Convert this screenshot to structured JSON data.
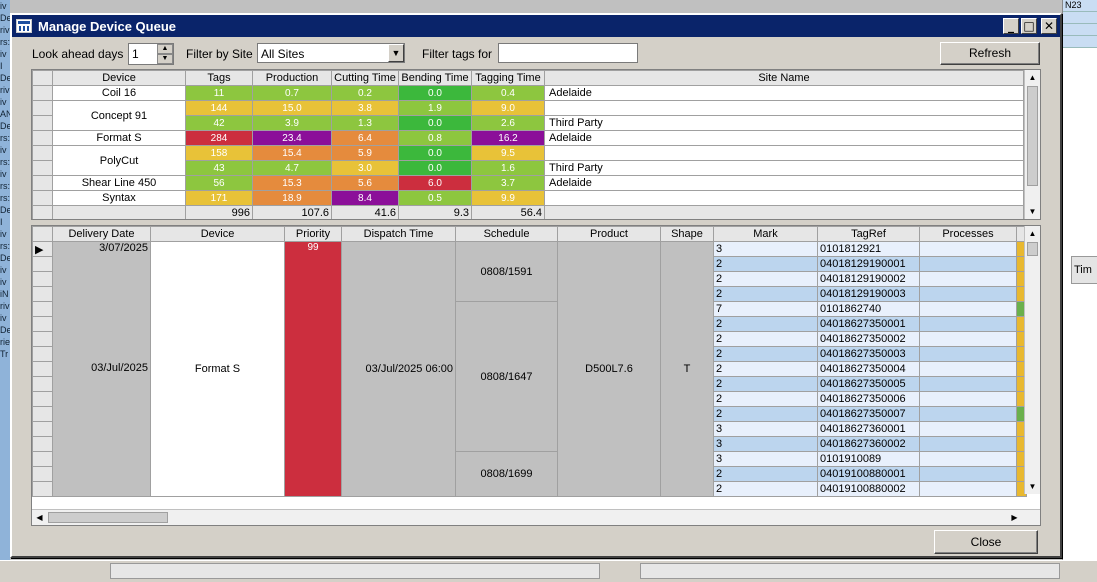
{
  "dialog": {
    "title": "Manage Device Queue",
    "minimize_glyph": "_",
    "maximize_glyph": "□",
    "close_glyph": "✕"
  },
  "toolbar": {
    "look_ahead_label": "Look ahead days",
    "look_ahead_value": "1",
    "filter_site_label": "Filter by Site",
    "filter_site_value": "All Sites",
    "filter_tags_label": "Filter tags for",
    "filter_tags_value": "",
    "refresh_label": "Refresh"
  },
  "summary": {
    "columns": [
      "Device",
      "Tags",
      "Production",
      "Cutting Time",
      "Bending Time",
      "Tagging Time",
      "Site Name"
    ],
    "devices": [
      {
        "name": "Coil 16",
        "rows": [
          {
            "tags": "11",
            "production": "0.7",
            "cutting": "0.2",
            "bending": "0.0",
            "tagging": "0.4",
            "site": "Adelaide",
            "colors": [
              "#8dc63f",
              "#8dc63f",
              "#8dc63f",
              "#3cb83c",
              "#8dc63f"
            ]
          }
        ]
      },
      {
        "name": "Concept 91",
        "rows": [
          {
            "tags": "144",
            "production": "15.0",
            "cutting": "3.8",
            "bending": "1.9",
            "tagging": "9.0",
            "site": "",
            "colors": [
              "#e8c238",
              "#e8c238",
              "#e8c238",
              "#8dc63f",
              "#e8c238"
            ]
          },
          {
            "tags": "42",
            "production": "3.9",
            "cutting": "1.3",
            "bending": "0.0",
            "tagging": "2.6",
            "site": "Third Party",
            "colors": [
              "#8dc63f",
              "#8dc63f",
              "#8dc63f",
              "#3cb83c",
              "#8dc63f"
            ]
          }
        ]
      },
      {
        "name": "Format S",
        "rows": [
          {
            "tags": "284",
            "production": "23.4",
            "cutting": "6.4",
            "bending": "0.8",
            "tagging": "16.2",
            "site": "Adelaide",
            "colors": [
              "#cc2e3e",
              "#8b0f99",
              "#e58b3d",
              "#8dc63f",
              "#8b0f99"
            ]
          }
        ]
      },
      {
        "name": "PolyCut",
        "rows": [
          {
            "tags": "158",
            "production": "15.4",
            "cutting": "5.9",
            "bending": "0.0",
            "tagging": "9.5",
            "site": "",
            "colors": [
              "#e8c238",
              "#e58b3d",
              "#e58b3d",
              "#3cb83c",
              "#e8c238"
            ]
          },
          {
            "tags": "43",
            "production": "4.7",
            "cutting": "3.0",
            "bending": "0.0",
            "tagging": "1.6",
            "site": "Third Party",
            "colors": [
              "#8dc63f",
              "#8dc63f",
              "#e8c238",
              "#3cb83c",
              "#8dc63f"
            ]
          }
        ]
      },
      {
        "name": "Shear Line 450",
        "rows": [
          {
            "tags": "56",
            "production": "15.3",
            "cutting": "5.6",
            "bending": "6.0",
            "tagging": "3.7",
            "site": "Adelaide",
            "colors": [
              "#8dc63f",
              "#e58b3d",
              "#e58b3d",
              "#cc2e3e",
              "#8dc63f"
            ]
          }
        ]
      },
      {
        "name": "Syntax",
        "rows": [
          {
            "tags": "171",
            "production": "18.9",
            "cutting": "8.4",
            "bending": "0.5",
            "tagging": "9.9",
            "site": "",
            "colors": [
              "#e8c238",
              "#e58b3d",
              "#8b0f99",
              "#8dc63f",
              "#e8c238"
            ]
          }
        ]
      }
    ],
    "totals": {
      "tags": "996",
      "production": "107.6",
      "cutting": "41.6",
      "bending": "9.3",
      "tagging": "56.4"
    }
  },
  "queue": {
    "columns": [
      "Delivery Date",
      "Device",
      "Priority",
      "Dispatch Time",
      "Schedule",
      "Product",
      "Shape",
      "Mark",
      "TagRef",
      "Processes"
    ],
    "first_row_date": "3/07/2025",
    "delivery_date": "03/Jul/2025",
    "device": "Format S",
    "priority": "99",
    "dispatch_time": "03/Jul/2025 06:00",
    "product": "D500L7.6",
    "shape": "T",
    "schedules": [
      {
        "id": "0808/1591",
        "rows": 4
      },
      {
        "id": "0808/1647",
        "rows": 10
      },
      {
        "id": "0808/1699",
        "rows": 3
      }
    ],
    "tags": [
      {
        "mark": "3",
        "tagref": "0101812921",
        "proc": "#e8b830"
      },
      {
        "mark": "2",
        "tagref": "04018129190001",
        "proc": "#e8b830"
      },
      {
        "mark": "2",
        "tagref": "04018129190002",
        "proc": "#e8b830"
      },
      {
        "mark": "2",
        "tagref": "04018129190003",
        "proc": "#e8b830"
      },
      {
        "mark": "7",
        "tagref": "0101862740",
        "proc": "#6ab04c"
      },
      {
        "mark": "2",
        "tagref": "04018627350001",
        "proc": "#e8b830"
      },
      {
        "mark": "2",
        "tagref": "04018627350002",
        "proc": "#e8b830"
      },
      {
        "mark": "2",
        "tagref": "04018627350003",
        "proc": "#e8b830"
      },
      {
        "mark": "2",
        "tagref": "04018627350004",
        "proc": "#e8b830"
      },
      {
        "mark": "2",
        "tagref": "04018627350005",
        "proc": "#e8b830"
      },
      {
        "mark": "2",
        "tagref": "04018627350006",
        "proc": "#e8b830"
      },
      {
        "mark": "2",
        "tagref": "04018627350007",
        "proc": "#6ab04c"
      },
      {
        "mark": "3",
        "tagref": "04018627360001",
        "proc": "#e8b830"
      },
      {
        "mark": "3",
        "tagref": "04018627360002",
        "proc": "#e8b830"
      },
      {
        "mark": "3",
        "tagref": "0101910089",
        "proc": "#e8b830"
      },
      {
        "mark": "2",
        "tagref": "04019100880001",
        "proc": "#e8b830"
      },
      {
        "mark": "2",
        "tagref": "04019100880002",
        "proc": "#e8b830"
      }
    ],
    "priority_color": "#cc2e3e"
  },
  "footer": {
    "close_label": "Close"
  },
  "background": {
    "right_header": "Tim",
    "left_labels": [
      "iv",
      "De",
      "riv",
      "rs:",
      "iv",
      "I",
      "De",
      "riv",
      "iv",
      "AN",
      "De",
      "rs:",
      "iv",
      "rs:",
      "iv",
      "rs:",
      "rs:",
      "De",
      "I",
      "iv",
      "rs:",
      "De",
      "iv",
      "iv",
      "iN",
      "riv",
      "iv",
      "De",
      "rie",
      "Tr"
    ],
    "right_cells": [
      "N23",
      "",
      "",
      ""
    ]
  }
}
